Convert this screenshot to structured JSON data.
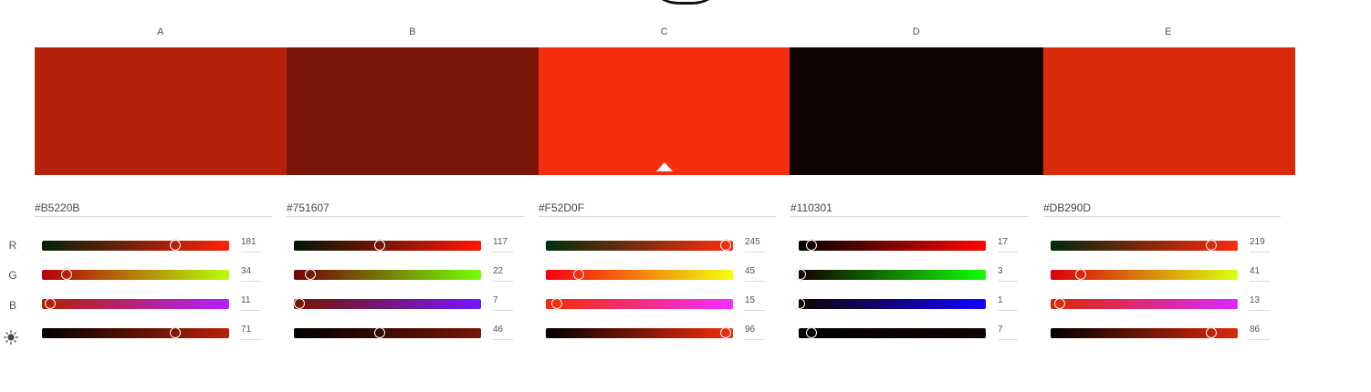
{
  "columns": [
    {
      "label": "A",
      "hex": "#B5220B",
      "r": 181,
      "g": 34,
      "b": 11,
      "brightness": 71
    },
    {
      "label": "B",
      "hex": "#751607",
      "r": 117,
      "g": 22,
      "b": 7,
      "brightness": 46
    },
    {
      "label": "C",
      "hex": "#F52D0F",
      "r": 245,
      "g": 45,
      "b": 15,
      "brightness": 96
    },
    {
      "label": "D",
      "hex": "#110301",
      "r": 17,
      "g": 3,
      "b": 1,
      "brightness": 7
    },
    {
      "label": "E",
      "hex": "#DB290D",
      "r": 219,
      "g": 41,
      "b": 13,
      "brightness": 86
    }
  ],
  "swatch_colors": [
    "#b5220b",
    "#7a160a",
    "#f52d0f",
    "#110301",
    "#db290d"
  ],
  "selected_column": "C",
  "row_labels": {
    "r": "R",
    "g": "G",
    "b": "B",
    "brightness_icon": "sun-icon"
  }
}
